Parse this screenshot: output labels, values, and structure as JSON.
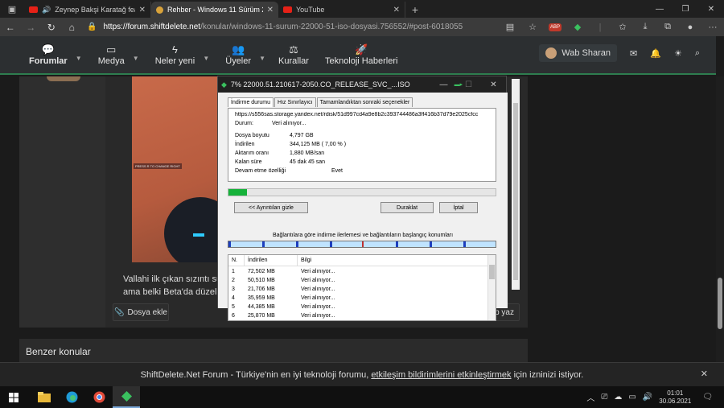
{
  "browser": {
    "tabs": [
      {
        "title": "Zeynep Bakşi Karatağ feat. ...",
        "favicon_color": "#e62117",
        "active": false
      },
      {
        "title": "Rehber - Windows 11 Sürüm 22000...",
        "favicon_color": "#d8a23a",
        "active": true
      },
      {
        "title": "YouTube",
        "favicon_color": "#e62117",
        "active": false
      }
    ],
    "url_host": "https://forum.shiftdelete.net",
    "url_path": "/konular/windows-11-surum-22000-51-iso-dosyasi.756552/#post-6018055",
    "badge_text": "ABP"
  },
  "forum_nav": {
    "items": [
      {
        "label": "Forumlar",
        "icon": "chat-bubbles-icon",
        "has_menu": true
      },
      {
        "label": "Medya",
        "icon": "video-icon",
        "has_menu": true
      },
      {
        "label": "Neler yeni",
        "icon": "bolt-icon",
        "has_menu": true
      },
      {
        "label": "Üyeler",
        "icon": "users-icon",
        "has_menu": true
      },
      {
        "label": "Kurallar",
        "icon": "scales-icon",
        "has_menu": false
      },
      {
        "label": "Teknoloji Haberleri",
        "icon": "rocket-icon",
        "has_menu": false
      }
    ],
    "username": "Wab Sharan"
  },
  "post": {
    "text_line1": "Vallahi ilk çıkan sızıntı sürü",
    "text_line2": "ama belki Beta'da düzelmi",
    "image_caption": "PRESS R TO CHANGE RIGHT",
    "attach_label": "Dosya ekle",
    "reply_label": "Cevap yaz"
  },
  "similar": {
    "title": "Benzer konular"
  },
  "notification": {
    "prefix": "ShiftDelete.Net Forum - Türkiye'nin en iyi teknoloji forumu,",
    "link": "etkileşim bildirimlerini etkinleştirmek",
    "suffix": "için izninizi istiyor."
  },
  "download_dialog": {
    "title": "7% 22000.51.210617-2050.CO_RELEASE_SVC_...ISO",
    "tabs": [
      "İndirme durumu",
      "Hız Sınırlayıcı",
      "Tamamlandıktan sonraki seçenekler"
    ],
    "url": "https://s556sas.storage.yandex.net/rdisk/51d997cd4a9e8b2c393744486a3ff416b37d79e2025cfcc",
    "status_label": "Durum:",
    "status_value": "Veri alınıyor...",
    "fields": [
      {
        "label": "Dosya boyutu",
        "value": "4,797  GB"
      },
      {
        "label": "İndirilen",
        "value": "344,125  MB  ( 7,00 % )"
      },
      {
        "label": "Aktarım oranı",
        "value": "1,880  MB/san"
      },
      {
        "label": "Kalan süre",
        "value": "45 dak 45 san"
      }
    ],
    "resume_label": "Devam etme özelliği",
    "resume_value": "Evet",
    "progress": 0.07,
    "buttons": {
      "details": "<< Ayrıntıları gizle",
      "pause": "Duraklat",
      "cancel": "İptal"
    },
    "connections_title": "Bağlantılara göre indirme ilerlemesi ve bağlantıların başlangıç konumları",
    "table_headers": [
      "N.",
      "İndirilen",
      "Bilgi"
    ],
    "connections": [
      {
        "n": "1",
        "downloaded": "72,502  MB",
        "info": "Veri alınıyor..."
      },
      {
        "n": "2",
        "downloaded": "50,510  MB",
        "info": "Veri alınıyor..."
      },
      {
        "n": "3",
        "downloaded": "21,706  MB",
        "info": "Veri alınıyor..."
      },
      {
        "n": "4",
        "downloaded": "35,959  MB",
        "info": "Veri alınıyor..."
      },
      {
        "n": "5",
        "downloaded": "44,385  MB",
        "info": "Veri alınıyor..."
      },
      {
        "n": "6",
        "downloaded": "25,870  MB",
        "info": "Veri alınıyor..."
      }
    ]
  },
  "taskbar": {
    "time": "01:01",
    "date": "30.06.2021"
  },
  "colors": {
    "accent_green": "#2e7d4f",
    "progress_green": "#16b23a",
    "segment_blue": "#1d3fbf"
  }
}
